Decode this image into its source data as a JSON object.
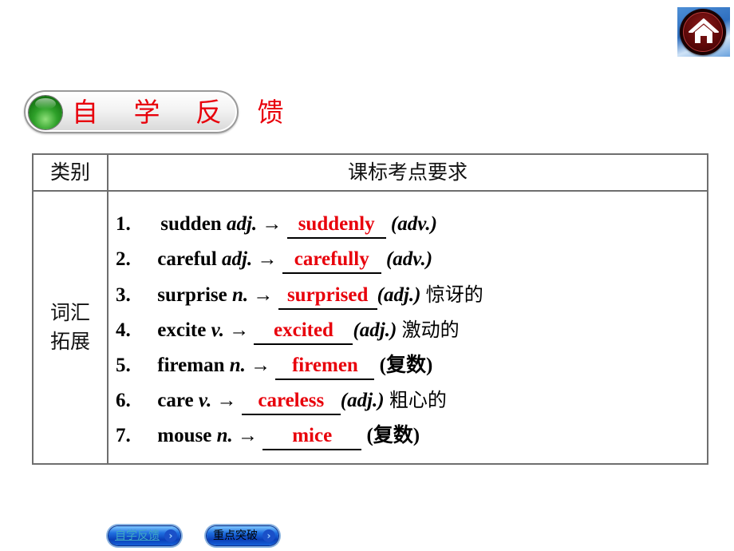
{
  "header": {
    "home_icon": "home-icon"
  },
  "section": {
    "title": "自 学 反 馈",
    "orb_icon": "green-orb-icon"
  },
  "table": {
    "headers": {
      "category": "类别",
      "requirements": "课标考点要求"
    },
    "category": {
      "line1": "词汇",
      "line2": "拓展"
    },
    "items": [
      {
        "num": "1.",
        "word": "sudden",
        "pos": "adj.",
        "arrow": "→",
        "answer": "suddenly",
        "target": "(adv.)",
        "meaning": ""
      },
      {
        "num": "2.",
        "word": "careful",
        "pos": "adj.",
        "arrow": "→",
        "answer": "carefully",
        "target": "(adv.)",
        "meaning": ""
      },
      {
        "num": "3.",
        "word": "surprise",
        "pos": "n.",
        "arrow": "→",
        "answer": "surprised",
        "target": "(adj.)",
        "meaning": "惊讶的"
      },
      {
        "num": "4.",
        "word": "excite",
        "pos": "v.",
        "arrow": "→",
        "answer": "excited",
        "target": "(adj.)",
        "meaning": "激动的"
      },
      {
        "num": "5.",
        "word": "fireman",
        "pos": "n.",
        "arrow": "→",
        "answer": "firemen",
        "target": "(复数)",
        "meaning": ""
      },
      {
        "num": "6.",
        "word": "care",
        "pos": "v.",
        "arrow": "→",
        "answer": "careless",
        "target": "(adj.)",
        "meaning": "粗心的"
      },
      {
        "num": "7.",
        "word": "mouse",
        "pos": "n.",
        "arrow": "→",
        "answer": "mice",
        "target": "(复数)",
        "meaning": ""
      }
    ]
  },
  "footer": {
    "nav": [
      {
        "label": "自学反馈",
        "icon": "chevron-right-icon"
      },
      {
        "label": "重点突破",
        "icon": "chevron-right-icon"
      }
    ]
  },
  "colors": {
    "answer": "#e8000b",
    "title": "#e8000b",
    "border": "#6e6e6e"
  }
}
